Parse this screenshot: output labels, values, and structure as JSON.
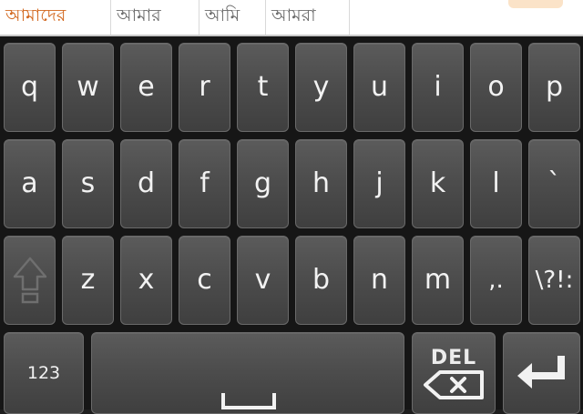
{
  "suggestions": [
    {
      "text": "আমাদের",
      "active": true
    },
    {
      "text": "আমার",
      "active": false
    },
    {
      "text": "আমি",
      "active": false
    },
    {
      "text": "আমরা",
      "active": false
    }
  ],
  "keyboard": {
    "row1": [
      "q",
      "w",
      "e",
      "r",
      "t",
      "y",
      "u",
      "i",
      "o",
      "p"
    ],
    "row2": [
      "a",
      "s",
      "d",
      "f",
      "g",
      "h",
      "j",
      "k",
      "l",
      "`"
    ],
    "row3": [
      "z",
      "x",
      "c",
      "v",
      "b",
      "n",
      "m",
      ",.",
      "\\?!:"
    ],
    "numbers_label": "123",
    "delete_label": "DEL",
    "icons": {
      "shift": "shift-icon",
      "space": "space-bar-icon",
      "delete": "backspace-icon",
      "enter": "enter-icon"
    }
  },
  "colors": {
    "suggestion_active": "#d2661c",
    "suggestion_text": "#6b6b6b",
    "key_face": "#4d4d4d",
    "key_text": "#f2f2f2",
    "keyboard_bg": "#161616"
  }
}
